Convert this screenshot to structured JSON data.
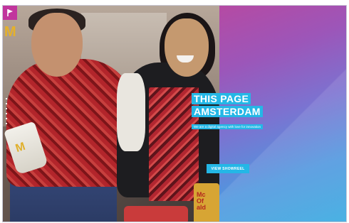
{
  "hero": {
    "headline_line1": "THIS PAGE",
    "headline_line2": "AMSTERDAM",
    "tagline": "We are a digital agency with love for innovation",
    "cta_label": "VIEW SHOWREEL"
  },
  "photo": {
    "cup_logo": "M",
    "cup2_text": "Mc\nOf\nald",
    "sign_logo": "M"
  },
  "colors": {
    "accent_cyan": "#24b7e6",
    "logo_magenta": "#c1359d",
    "gradient_top": "#b54aa3",
    "gradient_bottom": "#35a9e0"
  },
  "icons": {
    "logo": "flag-logo-icon"
  }
}
